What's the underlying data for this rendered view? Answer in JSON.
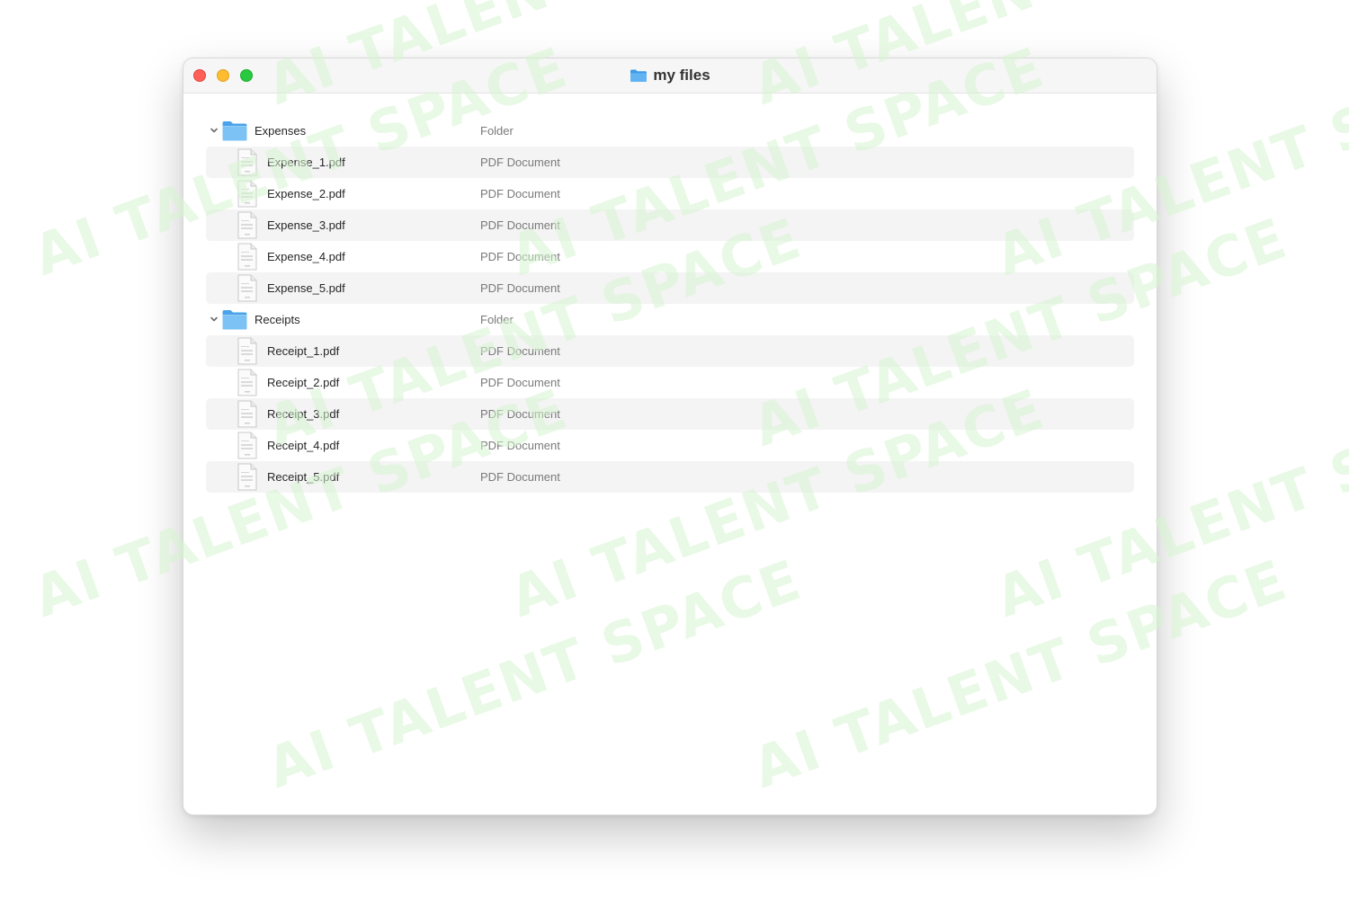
{
  "window": {
    "title": "my files",
    "title_icon": "folder-icon"
  },
  "watermark": {
    "text": "AI TALENT SPACE",
    "color": "#d6f5d0"
  },
  "colors": {
    "traffic_close": "#ff5f57",
    "traffic_minimize": "#febc2e",
    "traffic_zoom": "#28c840",
    "folder_blue": "#74b9ec",
    "row_alt": "#f4f4f4"
  },
  "rows": [
    {
      "type": "folder",
      "name": "Expenses",
      "kind": "Folder",
      "icon": "folder-icon",
      "expanded": true
    },
    {
      "type": "file",
      "name": "Expense_1.pdf",
      "kind": "PDF Document",
      "icon": "pdf-document-icon"
    },
    {
      "type": "file",
      "name": "Expense_2.pdf",
      "kind": "PDF Document",
      "icon": "pdf-document-icon"
    },
    {
      "type": "file",
      "name": "Expense_3.pdf",
      "kind": "PDF Document",
      "icon": "pdf-document-icon"
    },
    {
      "type": "file",
      "name": "Expense_4.pdf",
      "kind": "PDF Document",
      "icon": "pdf-document-icon"
    },
    {
      "type": "file",
      "name": "Expense_5.pdf",
      "kind": "PDF Document",
      "icon": "pdf-document-icon"
    },
    {
      "type": "folder",
      "name": "Receipts",
      "kind": "Folder",
      "icon": "folder-icon",
      "expanded": true
    },
    {
      "type": "file",
      "name": "Receipt_1.pdf",
      "kind": "PDF Document",
      "icon": "pdf-document-icon"
    },
    {
      "type": "file",
      "name": "Receipt_2.pdf",
      "kind": "PDF Document",
      "icon": "pdf-document-icon"
    },
    {
      "type": "file",
      "name": "Receipt_3.pdf",
      "kind": "PDF Document",
      "icon": "pdf-document-icon"
    },
    {
      "type": "file",
      "name": "Receipt_4.pdf",
      "kind": "PDF Document",
      "icon": "pdf-document-icon"
    },
    {
      "type": "file",
      "name": "Receipt_5.pdf",
      "kind": "PDF Document",
      "icon": "pdf-document-icon"
    }
  ]
}
